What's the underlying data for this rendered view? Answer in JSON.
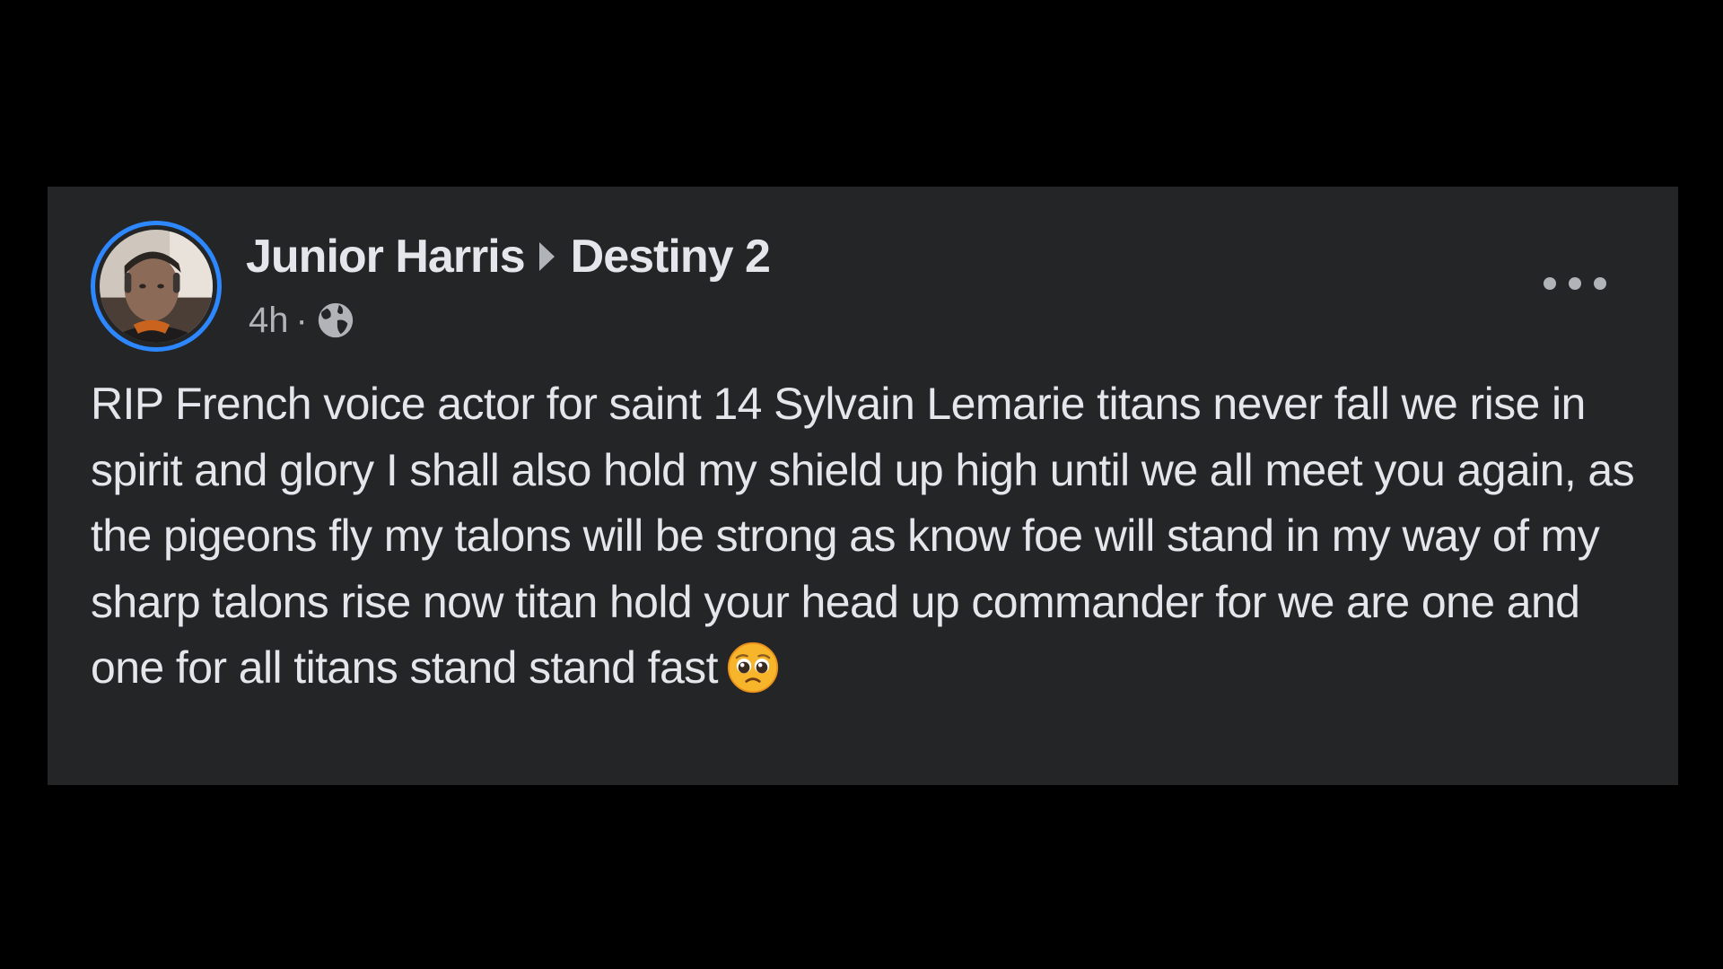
{
  "post": {
    "author": "Junior Harris",
    "group": "Destiny 2",
    "timestamp": "4h",
    "separator": "·",
    "audience_icon": "globe-icon",
    "more_icon": "more-options-icon",
    "body_text": "RIP French voice actor for saint 14 Sylvain Lemarie titans never fall we rise in spirit and glory I shall also hold my shield up high until we all meet you again, as the pigeons fly my talons will be strong as know foe will stand in my way of my sharp talons rise now titan hold your head up commander for we are one and one for all titans stand stand fast",
    "emoji": "pleading-face-emoji"
  },
  "colors": {
    "page_background": "#000000",
    "card_background": "#242526",
    "primary_text": "#e4e6eb",
    "secondary_text": "#b0b3b8",
    "avatar_ring": "#2d88ff"
  }
}
